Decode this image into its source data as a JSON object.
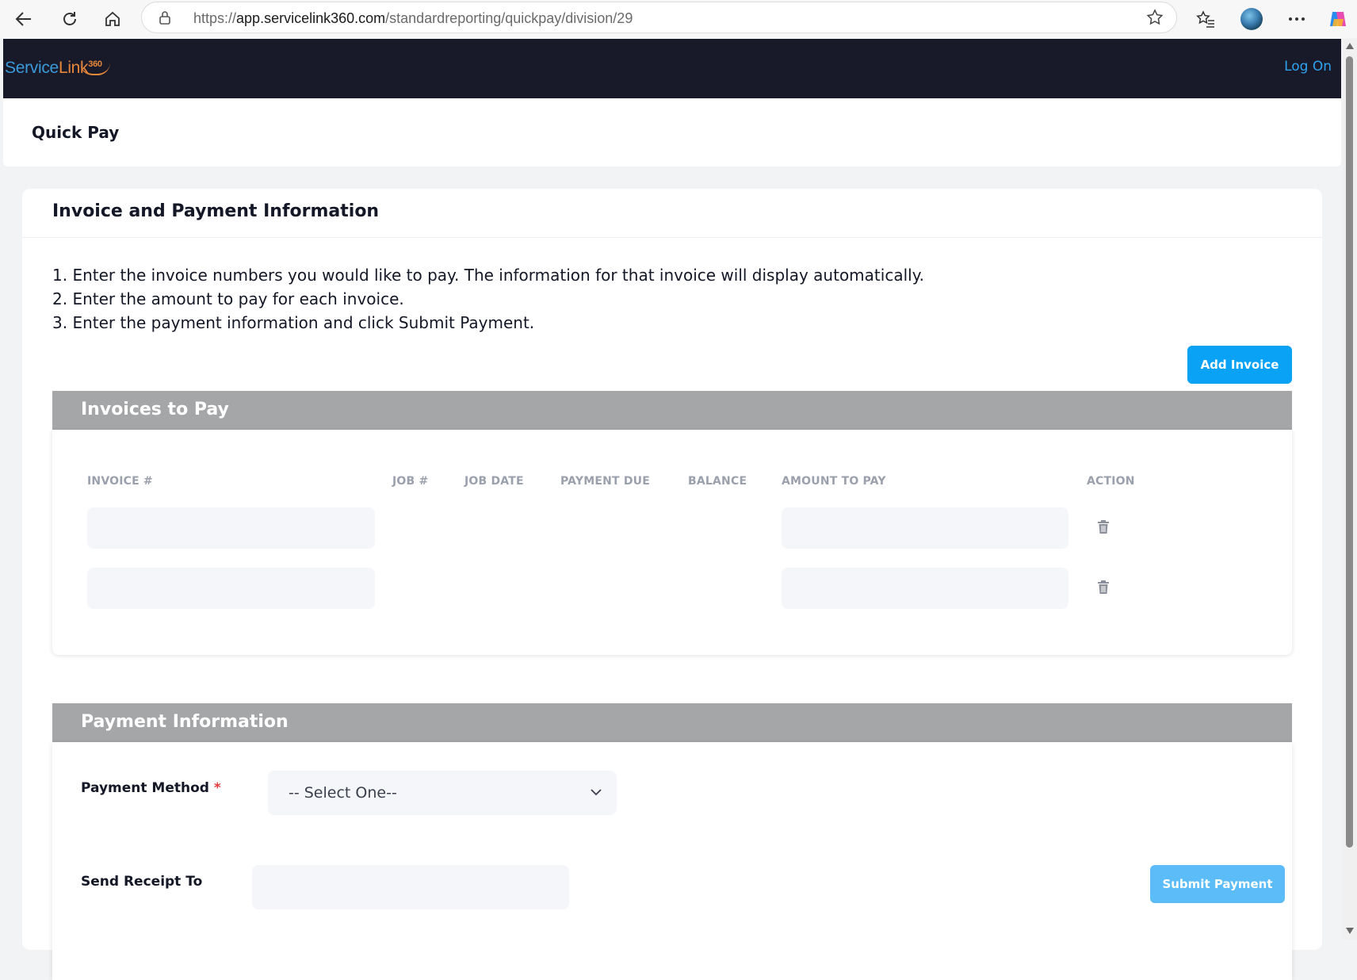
{
  "browser": {
    "url_prefix": "https://",
    "url_host": "app.servicelink360.com",
    "url_path": "/standardreporting/quickpay/division/29"
  },
  "header": {
    "logo_service": "Service",
    "logo_link": "Link",
    "logo_360": "360",
    "logon_label": "Log On"
  },
  "page": {
    "title": "Quick Pay"
  },
  "card": {
    "title": "Invoice and Payment Information",
    "instructions": [
      "1. Enter the invoice numbers you would like to pay. The information for that invoice will display automatically.",
      "2. Enter the amount to pay for each invoice.",
      "3. Enter the payment information and click Submit Payment."
    ],
    "add_invoice_label": "Add Invoice"
  },
  "invoices": {
    "section_title": "Invoices to Pay",
    "columns": [
      "INVOICE #",
      "JOB #",
      "JOB DATE",
      "PAYMENT DUE",
      "BALANCE",
      "AMOUNT TO PAY",
      "ACTION"
    ],
    "rows": [
      {
        "invoice": "",
        "job": "",
        "job_date": "",
        "payment_due": "",
        "balance": "",
        "amount": ""
      },
      {
        "invoice": "",
        "job": "",
        "job_date": "",
        "payment_due": "",
        "balance": "",
        "amount": ""
      }
    ]
  },
  "payment": {
    "section_title": "Payment Information",
    "method_label": "Payment Method",
    "required_mark": "*",
    "method_selected": "-- Select One--",
    "receipt_label": "Send Receipt To",
    "receipt_value": "",
    "submit_label": "Submit Payment"
  },
  "colors": {
    "header_bg": "#181a2a",
    "primary_button": "#0aa2f5",
    "disabled_button": "#5bbcf7",
    "section_bar": "#a5a6a8",
    "required": "#e03a3a"
  }
}
